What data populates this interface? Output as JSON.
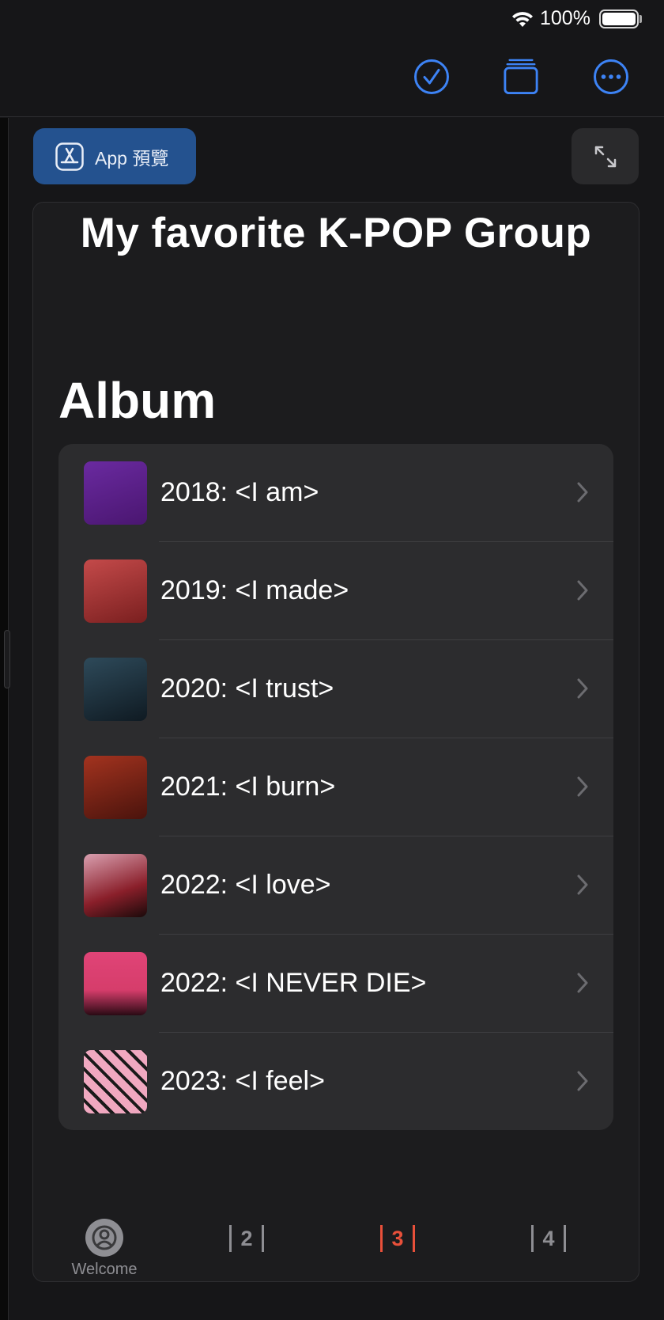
{
  "status_bar": {
    "battery_percent": "100%"
  },
  "toolbar": {
    "icons": [
      "checkmark-circle-icon",
      "stack-icon",
      "ellipsis-circle-icon"
    ],
    "accent": "#3d83f5"
  },
  "app_preview": {
    "label": "App 預覽",
    "icon": "app-store-icon"
  },
  "page": {
    "title": "My favorite K-POP Group",
    "section": "Album"
  },
  "albums": [
    {
      "title": "2018: <I am>",
      "cover_color": "#5a1f8a"
    },
    {
      "title": "2019: <I made>",
      "cover_color": "#b23a3a"
    },
    {
      "title": "2020: <I trust>",
      "cover_color": "#1f3340"
    },
    {
      "title": "2021: <I burn>",
      "cover_color": "#8a2a1e"
    },
    {
      "title": "2022: <I love>",
      "cover_color": "#c24b5a"
    },
    {
      "title": "2022: <I NEVER DIE>",
      "cover_color": "#d63d6b"
    },
    {
      "title": "2023: <I feel>",
      "cover_color": "#e8a0b8"
    }
  ],
  "bottom_tabs": {
    "welcome_label": "Welcome",
    "tab2": "2",
    "tab3": "3",
    "tab4": "4",
    "active_color": "#e8503a",
    "inactive_color": "#8e8e93"
  }
}
